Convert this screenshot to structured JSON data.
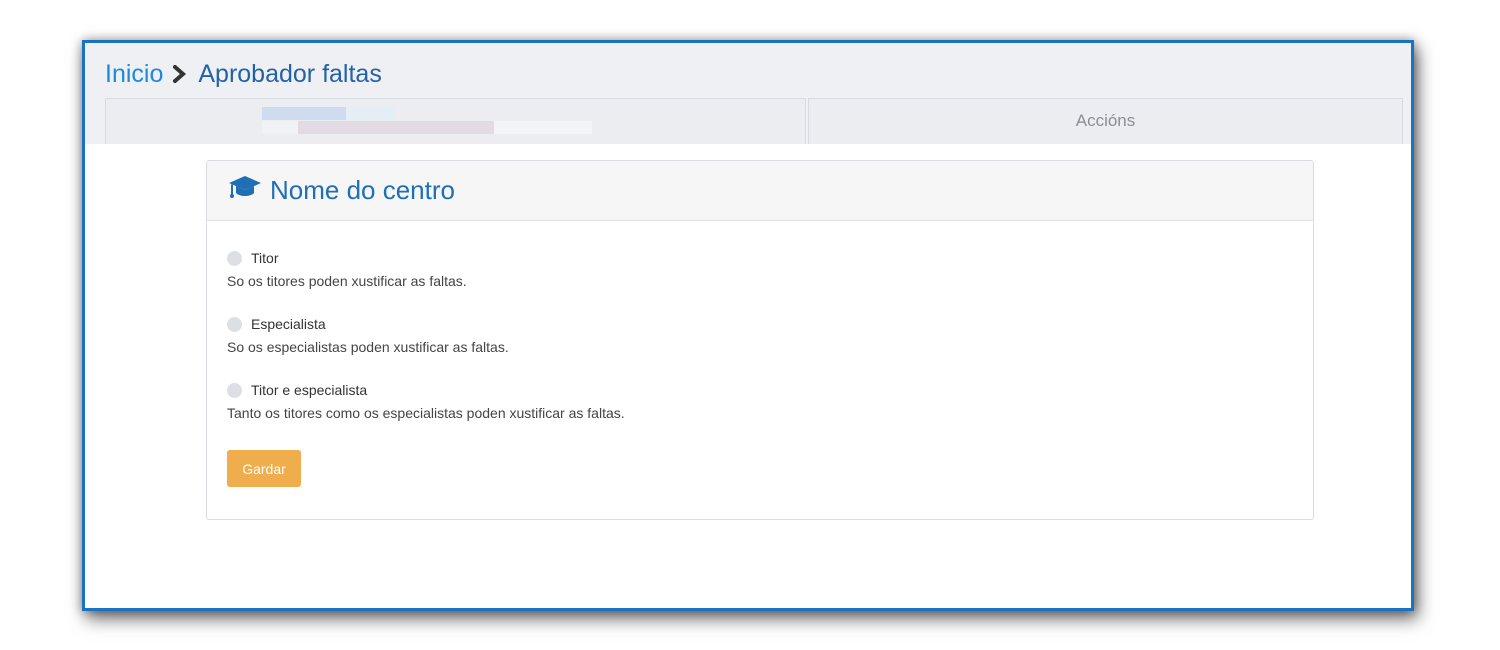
{
  "breadcrumb": {
    "home_label": "Inicio",
    "current_label": "Aprobador faltas"
  },
  "tabs": {
    "user_tab_blurred": true,
    "actions_label": "Accións"
  },
  "panel": {
    "icon": "graduation-cap-icon",
    "title": "Nome do centro"
  },
  "options": [
    {
      "label": "Titor",
      "description": "So os titores poden xustificar as faltas."
    },
    {
      "label": "Especialista",
      "description": "So os especialistas poden xustificar as faltas."
    },
    {
      "label": "Titor e especialista",
      "description": "Tanto os titores como os especialistas poden xustificar as faltas."
    }
  ],
  "save_button": {
    "label": "Gardar"
  },
  "colors": {
    "link": "#1f8ad6",
    "title": "#1f6fb5",
    "frame_border": "#1a73c0",
    "save_button": "#f0ad4e"
  }
}
